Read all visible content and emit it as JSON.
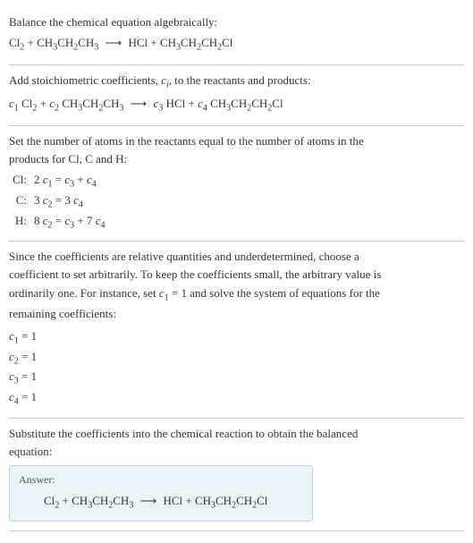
{
  "section1": {
    "line1": "Balance the chemical equation algebraically:",
    "eq_parts": {
      "cl2": "Cl",
      "cl2_sub": "2",
      "plus1": " + CH",
      "ch3_sub1": "3",
      "ch2": "CH",
      "ch2_sub1": "2",
      "ch3_2": "CH",
      "ch3_sub2": "3",
      "arrow": "⟶",
      "hcl": "HCl + CH",
      "p_ch3_sub": "3",
      "p_ch2": "CH",
      "p_ch2_sub": "2",
      "p_ch2_2": "CH",
      "p_ch2_2_sub": "2",
      "p_cl": "Cl"
    }
  },
  "section2": {
    "line1_a": "Add stoichiometric coefficients, ",
    "line1_ci": "c",
    "line1_ci_sub": "i",
    "line1_b": ", to the reactants and products:",
    "c1": "c",
    "c1_sub": "1",
    "sp1": " Cl",
    "cl2_sub": "2",
    "plus": " + ",
    "c2": "c",
    "c2_sub": "2",
    "sp2": " CH",
    "ch3_sub1": "3",
    "ch2": "CH",
    "ch2_sub": "2",
    "ch3_2": "CH",
    "ch3_sub2": "3",
    "arrow": "⟶",
    "c3": "c",
    "c3_sub": "3",
    "sp3": " HCl + ",
    "c4": "c",
    "c4_sub": "4",
    "sp4": " CH",
    "p_ch3_sub": "3",
    "p_ch2": "CH",
    "p_ch2_sub": "2",
    "p_ch2_2": "CH",
    "p_ch2_2_sub": "2",
    "p_cl": "Cl"
  },
  "section3": {
    "line1": "Set the number of atoms in the reactants equal to the number of atoms in the",
    "line2": "products for Cl, C and H:",
    "rows": [
      {
        "label": "Cl:",
        "pre": "2 ",
        "c_a": "c",
        "sub_a": "1",
        "mid": " = ",
        "c_b": "c",
        "sub_b": "3",
        "mid2": " + ",
        "c_c": "c",
        "sub_c": "4",
        "post": ""
      },
      {
        "label": "C:",
        "pre": "3 ",
        "c_a": "c",
        "sub_a": "2",
        "mid": " = 3 ",
        "c_b": "c",
        "sub_b": "4",
        "mid2": "",
        "c_c": "",
        "sub_c": "",
        "post": ""
      },
      {
        "label": "H:",
        "pre": "8 ",
        "c_a": "c",
        "sub_a": "2",
        "mid": " = ",
        "c_b": "c",
        "sub_b": "3",
        "mid2": " + 7 ",
        "c_c": "c",
        "sub_c": "4",
        "post": ""
      }
    ]
  },
  "section4": {
    "para_a": "Since the coefficients are relative quantities and underdetermined, choose a",
    "para_b": "coefficient to set arbitrarily. To keep the coefficients small, the arbitrary value is",
    "para_c_a": "ordinarily one. For instance, set ",
    "para_c_c": "c",
    "para_c_sub": "1",
    "para_c_b": " = 1 and solve the system of equations for the",
    "para_d": "remaining coefficients:",
    "coefs": [
      {
        "c": "c",
        "sub": "1",
        "val": " = 1"
      },
      {
        "c": "c",
        "sub": "2",
        "val": " = 1"
      },
      {
        "c": "c",
        "sub": "3",
        "val": " = 1"
      },
      {
        "c": "c",
        "sub": "4",
        "val": " = 1"
      }
    ]
  },
  "section5": {
    "line1": "Substitute the coefficients into the chemical reaction to obtain the balanced",
    "line2": "equation:",
    "answer_label": "Answer:",
    "eq": {
      "cl2": "Cl",
      "cl2_sub": "2",
      "plus1": " + CH",
      "ch3_sub1": "3",
      "ch2": "CH",
      "ch2_sub1": "2",
      "ch3_2": "CH",
      "ch3_sub2": "3",
      "arrow": "⟶",
      "hcl": "HCl + CH",
      "p_ch3_sub": "3",
      "p_ch2": "CH",
      "p_ch2_sub": "2",
      "p_ch2_2": "CH",
      "p_ch2_2_sub": "2",
      "p_cl": "Cl"
    }
  }
}
